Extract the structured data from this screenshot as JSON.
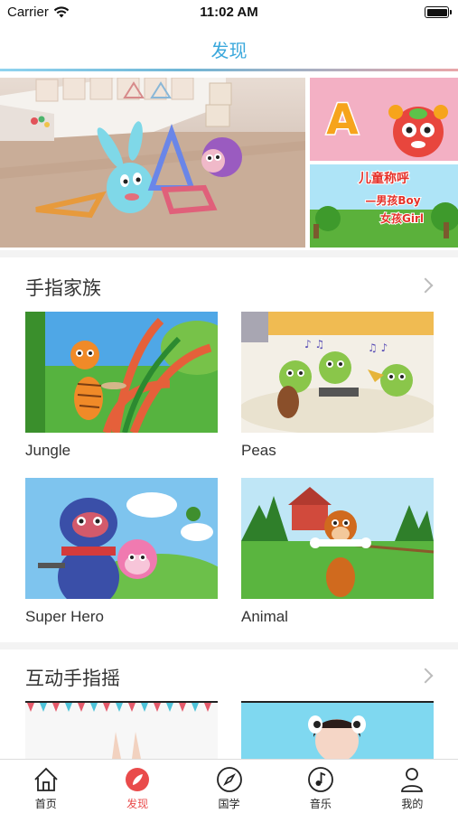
{
  "status_bar": {
    "carrier": "Carrier",
    "time": "11:02 AM"
  },
  "nav": {
    "title": "发现",
    "accent_color": "#3aa8dc"
  },
  "banner": {
    "side_top_text": "A",
    "side_bottom_title": "儿童称呼",
    "side_bottom_line1": "—男孩Boy",
    "side_bottom_line2": "女孩Girl"
  },
  "sections": [
    {
      "title": "手指家族",
      "items": [
        {
          "label": "Jungle"
        },
        {
          "label": "Peas"
        },
        {
          "label": "Super Hero"
        },
        {
          "label": "Animal"
        }
      ]
    },
    {
      "title": "互动手指摇"
    }
  ],
  "tabs": [
    {
      "label": "首页",
      "icon": "home-icon"
    },
    {
      "label": "发现",
      "icon": "discover-icon",
      "active": true
    },
    {
      "label": "国学",
      "icon": "compass-icon"
    },
    {
      "label": "音乐",
      "icon": "music-icon"
    },
    {
      "label": "我的",
      "icon": "person-icon"
    }
  ],
  "colors": {
    "active_tab": "#e94b4b",
    "nav_title": "#3aa8dc"
  }
}
